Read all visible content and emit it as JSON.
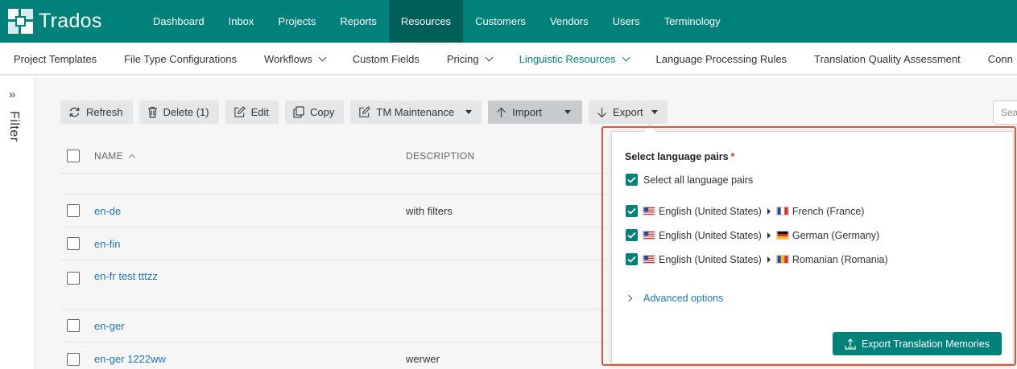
{
  "app": {
    "name": "Trados"
  },
  "topnav": [
    {
      "label": "Dashboard"
    },
    {
      "label": "Inbox"
    },
    {
      "label": "Projects"
    },
    {
      "label": "Reports"
    },
    {
      "label": "Resources",
      "active": true
    },
    {
      "label": "Customers"
    },
    {
      "label": "Vendors"
    },
    {
      "label": "Users"
    },
    {
      "label": "Terminology"
    }
  ],
  "subnav": [
    {
      "label": "Project Templates"
    },
    {
      "label": "File Type Configurations"
    },
    {
      "label": "Workflows"
    },
    {
      "label": "Custom Fields"
    },
    {
      "label": "Pricing"
    },
    {
      "label": "Linguistic Resources"
    },
    {
      "label": "Language Processing Rules"
    },
    {
      "label": "Translation Quality Assessment"
    },
    {
      "label": "Conn"
    }
  ],
  "filter": {
    "label": "Filter",
    "arrows": "»"
  },
  "toolbar": {
    "refresh": "Refresh",
    "delete": "Delete (1)",
    "edit": "Edit",
    "copy": "Copy",
    "tm_maintenance": "TM Maintenance",
    "import": "Import",
    "export": "Export"
  },
  "search": {
    "placeholder": "Sea"
  },
  "table": {
    "headers": {
      "name": "NAME",
      "description": "DESCRIPTION"
    },
    "rows": [
      {
        "name": "",
        "description": ""
      },
      {
        "name": "en-de",
        "description": "with filters"
      },
      {
        "name": "en-fin",
        "description": ""
      },
      {
        "name": "en-fr test tttzz",
        "description": ""
      },
      {
        "name": "en-ger",
        "description": ""
      },
      {
        "name": "en-ger 1222ww",
        "description": "werwer"
      }
    ]
  },
  "export_popup": {
    "title": "Select language pairs",
    "required_mark": "*",
    "select_all": "Select all language pairs",
    "pairs": [
      {
        "source": "English (United States)",
        "target": "French (France)",
        "source_flag": "us-flag-icon",
        "target_flag": "fr-flag-icon",
        "checked": true
      },
      {
        "source": "English (United States)",
        "target": "German (Germany)",
        "source_flag": "us-flag-icon",
        "target_flag": "de-flag-icon",
        "checked": true
      },
      {
        "source": "English (United States)",
        "target": "Romanian (Romania)",
        "source_flag": "us-flag-icon",
        "target_flag": "ro-flag-icon",
        "checked": true
      }
    ],
    "advanced": "Advanced options",
    "button": "Export Translation Memories"
  },
  "colors": {
    "brand": "#008179",
    "brand_dark": "#005f59",
    "link": "#1c78b8",
    "highlight": "#e2553a"
  }
}
